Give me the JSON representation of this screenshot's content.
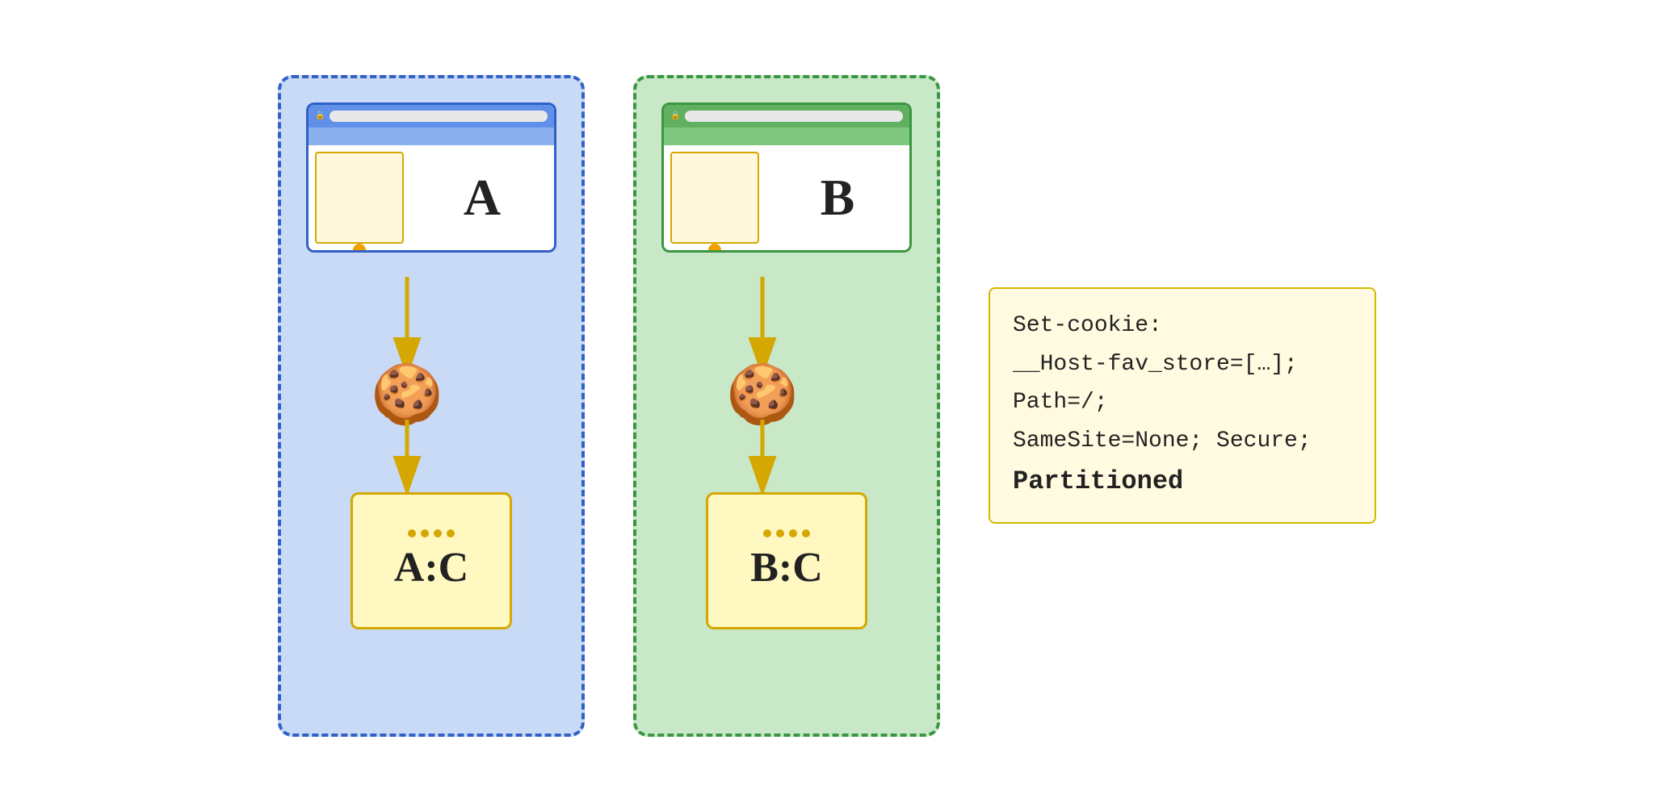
{
  "partitions": [
    {
      "id": "partition-a",
      "color": "blue",
      "browser_label": "A",
      "storage_label": "A:C",
      "border_color": "#3060c8",
      "bg_color": "#c8daf5",
      "titlebar_color": "#6090e8",
      "toolbar_color": "#8ab0f0",
      "frame_color": "#3060c8"
    },
    {
      "id": "partition-b",
      "color": "green",
      "browser_label": "B",
      "storage_label": "B:C",
      "border_color": "#3a9640",
      "bg_color": "#c8e8c8",
      "titlebar_color": "#60b060",
      "toolbar_color": "#80c880",
      "frame_color": "#3a9640"
    }
  ],
  "code": {
    "lines": [
      "Set-cookie:",
      "__Host-fav_store=[…];",
      "Path=/;",
      "SameSite=None; Secure;",
      "Partitioned"
    ],
    "bold_line_index": 4
  },
  "icons": {
    "lock": "🔒",
    "cookie": "🍪"
  }
}
